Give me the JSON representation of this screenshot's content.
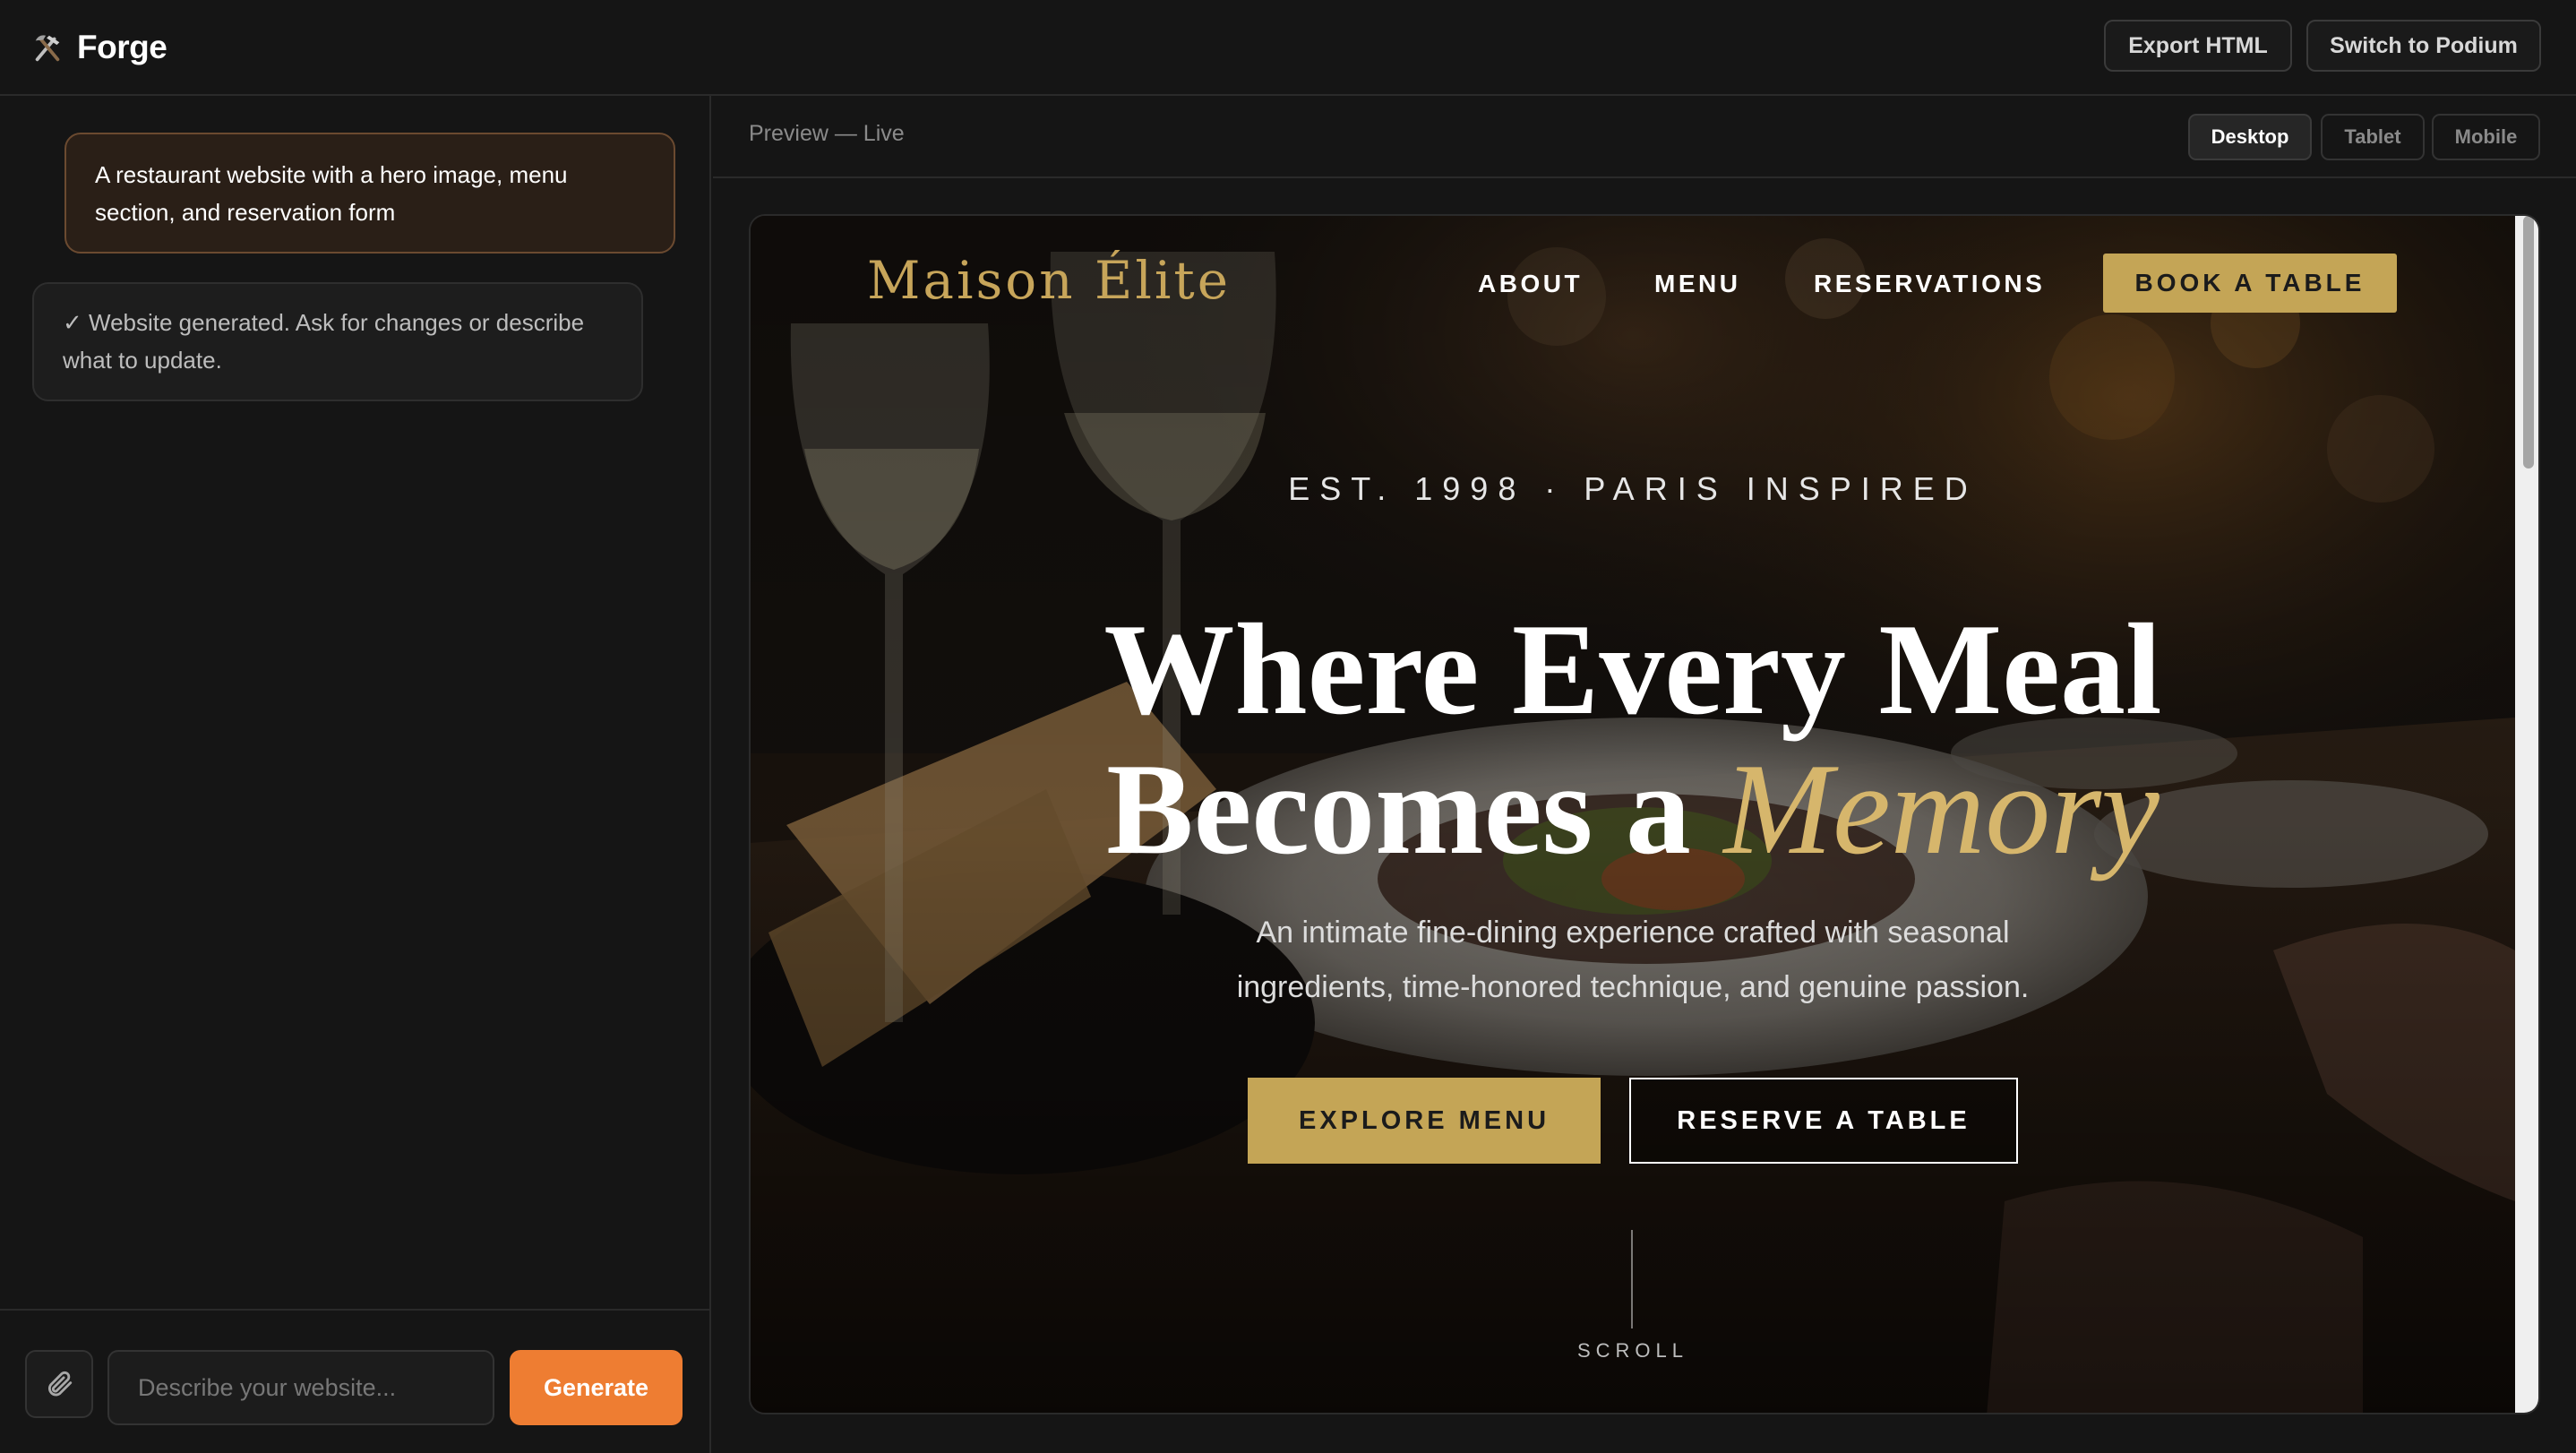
{
  "app": {
    "name": "Forge",
    "export_label": "Export HTML",
    "switch_label": "Switch to Podium"
  },
  "chat": {
    "user_message": "A restaurant website with a hero image, menu section, and reservation form",
    "assistant_message": "✓ Website generated. Ask for changes or describe what to update."
  },
  "composer": {
    "placeholder": "Describe your website...",
    "value": "",
    "generate_label": "Generate"
  },
  "preview": {
    "label": "Preview — Live",
    "views": {
      "desktop": "Desktop",
      "tablet": "Tablet",
      "mobile": "Mobile"
    },
    "selected_view": "Desktop"
  },
  "site": {
    "logo": "Maison Élite",
    "nav": {
      "about": "ABOUT",
      "menu": "MENU",
      "reservations": "RESERVATIONS"
    },
    "book_label": "BOOK A TABLE",
    "eyebrow": "EST. 1998 · PARIS INSPIRED",
    "headline_line1": "Where Every Meal",
    "headline_line2_plain": "Becomes a ",
    "headline_line2_accent": "Memory",
    "subtext_line1": "An intimate fine-dining experience crafted with seasonal",
    "subtext_line2": "ingredients, time-honored technique, and genuine passion.",
    "cta_primary": "EXPLORE MENU",
    "cta_secondary": "RESERVE A TABLE",
    "scroll_label": "SCROLL"
  },
  "colors": {
    "accent_orange": "#ee7d32",
    "gold": "#c4a556",
    "gold_italic": "#d6b66c",
    "background": "#151515",
    "user_bubble": "#2a1f17"
  },
  "icons": {
    "brand": "hammer-pick-icon",
    "attach": "paperclip-icon"
  }
}
